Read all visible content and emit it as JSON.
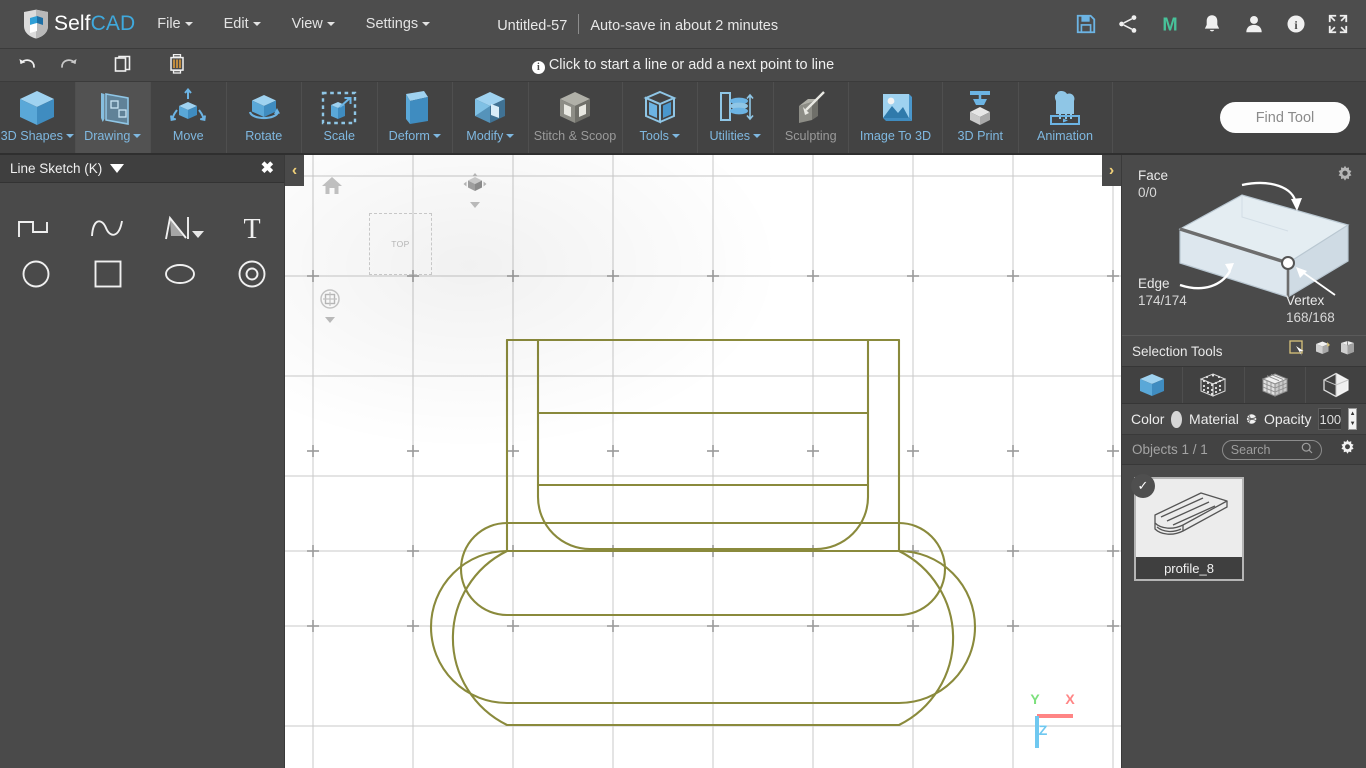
{
  "app": {
    "brand_self": "Self",
    "brand_cad": "CAD",
    "accent_blue": "#3fa9dd",
    "toolbar_label_blue": "#7fb8e0",
    "sketch_color": "#8a8a3c"
  },
  "menubar": {
    "items": [
      {
        "label": "File",
        "caret": true
      },
      {
        "label": "Edit",
        "caret": true
      },
      {
        "label": "View",
        "caret": true
      },
      {
        "label": "Settings",
        "caret": true
      }
    ],
    "document_title": "Untitled-57",
    "autosave": "Auto-save in about 2 minutes",
    "right_icons": [
      {
        "name": "save-icon",
        "title": "Save"
      },
      {
        "name": "share-icon",
        "title": "Share"
      },
      {
        "name": "mycad-icon",
        "title": "M"
      },
      {
        "name": "notifications-icon",
        "title": "Notifications"
      },
      {
        "name": "account-icon",
        "title": "Account"
      },
      {
        "name": "info-icon",
        "title": "Info"
      },
      {
        "name": "fullscreen-icon",
        "title": "Fullscreen"
      }
    ]
  },
  "undobar": {
    "buttons": [
      {
        "name": "undo-button",
        "title": "Undo"
      },
      {
        "name": "redo-button",
        "title": "Redo"
      },
      {
        "name": "copy-button",
        "title": "Copy"
      },
      {
        "name": "delete-button",
        "title": "Delete"
      }
    ],
    "hint": "Click to start a line or add a next point to line",
    "hint_icon": "i"
  },
  "toolbar": {
    "tools": [
      {
        "label": "3D Shapes",
        "caret": true,
        "active": false,
        "disabled": false,
        "icon": "cube-icon"
      },
      {
        "label": "Drawing",
        "caret": true,
        "active": true,
        "disabled": false,
        "icon": "drawing-icon"
      },
      {
        "label": "Move",
        "caret": false,
        "active": false,
        "disabled": false,
        "icon": "move-icon"
      },
      {
        "label": "Rotate",
        "caret": false,
        "active": false,
        "disabled": false,
        "icon": "rotate-icon"
      },
      {
        "label": "Scale",
        "caret": false,
        "active": false,
        "disabled": false,
        "icon": "scale-icon"
      },
      {
        "label": "Deform",
        "caret": true,
        "active": false,
        "disabled": false,
        "icon": "deform-icon"
      },
      {
        "label": "Modify",
        "caret": true,
        "active": false,
        "disabled": false,
        "icon": "modify-icon"
      },
      {
        "label": "Stitch & Scoop",
        "caret": false,
        "active": false,
        "disabled": true,
        "icon": "stitch-scoop-icon"
      },
      {
        "label": "Tools",
        "caret": true,
        "active": false,
        "disabled": false,
        "icon": "tools-icon"
      },
      {
        "label": "Utilities",
        "caret": true,
        "active": false,
        "disabled": false,
        "icon": "utilities-icon"
      },
      {
        "label": "Sculpting",
        "caret": false,
        "active": false,
        "disabled": true,
        "icon": "sculpting-icon"
      },
      {
        "label": "Image To 3D",
        "caret": false,
        "active": false,
        "disabled": false,
        "icon": "image-to-3d-icon"
      },
      {
        "label": "3D Print",
        "caret": false,
        "active": false,
        "disabled": false,
        "icon": "3d-print-icon"
      },
      {
        "label": "Animation",
        "caret": false,
        "active": false,
        "disabled": false,
        "icon": "animation-icon"
      }
    ],
    "find_tool_placeholder": "Find Tool"
  },
  "left_panel": {
    "title": "Line Sketch (K)",
    "close_label": "✖",
    "tools": [
      {
        "name": "polyline-tool",
        "label": "Polyline"
      },
      {
        "name": "freehand-curve-tool",
        "label": "Freehand Curve"
      },
      {
        "name": "pen-tool",
        "label": "Pen",
        "has_dropdown": true
      },
      {
        "name": "text-tool",
        "label": "Text"
      },
      {
        "name": "circle-tool",
        "label": "Circle"
      },
      {
        "name": "rectangle-tool",
        "label": "Rectangle"
      },
      {
        "name": "ellipse-tool",
        "label": "Ellipse"
      },
      {
        "name": "ring-tool",
        "label": "Ring"
      }
    ]
  },
  "viewport": {
    "view_label": "TOP",
    "left_toggle": "‹",
    "right_toggle": "›",
    "axes": [
      {
        "label": "X",
        "color": "#ff8585"
      },
      {
        "label": "Y",
        "color": "#7ce07c"
      },
      {
        "label": "Z",
        "color": "#6fc8f0"
      }
    ],
    "nav": [
      {
        "name": "home-view-icon",
        "label": "Home"
      },
      {
        "name": "view-cube-icon",
        "label": "View Cube"
      },
      {
        "name": "snap-settings-icon",
        "label": "Snap Settings"
      }
    ]
  },
  "right_panel": {
    "selection": {
      "face_label": "Face",
      "face_value": "0/0",
      "edge_label": "Edge",
      "edge_value": "174/174",
      "vertex_label": "Vertex",
      "vertex_value": "168/168",
      "gear_name": "selection-settings-gear-icon"
    },
    "selection_tools": {
      "label": "Selection Tools",
      "icons": [
        {
          "name": "rectangle-select-icon"
        },
        {
          "name": "paint-select-icon"
        },
        {
          "name": "box-select-icon"
        }
      ]
    },
    "view_modes": [
      {
        "name": "solid-view-icon",
        "active": true
      },
      {
        "name": "points-view-icon",
        "active": false
      },
      {
        "name": "wireframe-view-icon",
        "active": false
      },
      {
        "name": "shaded-view-icon",
        "active": false
      }
    ],
    "properties": {
      "color_label": "Color",
      "color_value": "#d6d6d6",
      "material_label": "Material",
      "opacity_label": "Opacity",
      "opacity_value": "100"
    },
    "objects": {
      "header": "Objects 1 / 1",
      "search_placeholder": "Search",
      "gear_name": "objects-settings-gear-icon",
      "items": [
        {
          "name": "profile_8",
          "selected": true,
          "check": "✓"
        }
      ]
    }
  }
}
